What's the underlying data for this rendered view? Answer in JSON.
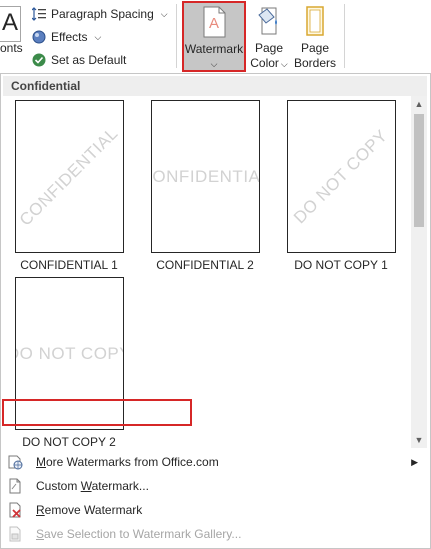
{
  "ribbon": {
    "font_glyph": "A",
    "fonts_label": "onts",
    "paragraph_spacing_label": "Paragraph Spacing",
    "effects_label": "Effects",
    "set_default_label": "Set as Default",
    "watermark_label": "Watermark",
    "page_color_line1": "Page",
    "page_color_line2": "Color",
    "page_borders_line1": "Page",
    "page_borders_line2": "Borders"
  },
  "panel": {
    "section_header": "Confidential",
    "tiles": [
      {
        "label": "CONFIDENTIAL 1",
        "watermark": "CONFIDENTIAL"
      },
      {
        "label": "CONFIDENTIAL 2",
        "watermark": "CONFIDENTIAL"
      },
      {
        "label": "DO NOT COPY 1",
        "watermark": "DO NOT COPY"
      },
      {
        "label": "DO NOT COPY 2",
        "watermark": "DO NOT COPY"
      }
    ],
    "menu": {
      "more_pre": "",
      "more_ul": "M",
      "more_post": "ore Watermarks from Office.com",
      "custom_pre": "Custom ",
      "custom_ul": "W",
      "custom_post": "atermark...",
      "remove_pre": "",
      "remove_ul": "R",
      "remove_post": "emove Watermark",
      "save_pre": "",
      "save_ul": "S",
      "save_post": "ave Selection to Watermark Gallery..."
    }
  },
  "colors": {
    "highlight_red": "#d62727",
    "pressed_gray": "#c6c6c6",
    "watermark_gray": "#d2d2d2"
  }
}
